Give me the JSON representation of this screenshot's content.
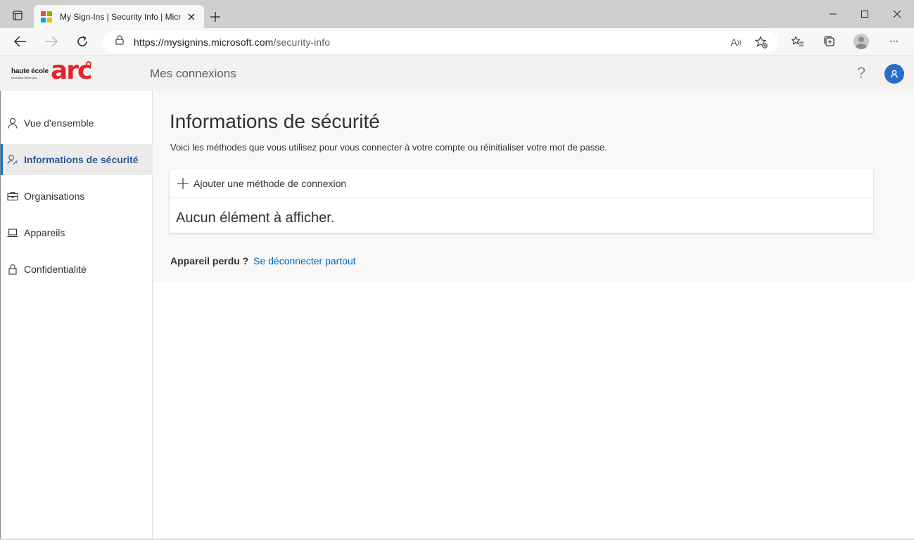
{
  "browser": {
    "tab": {
      "title": "My Sign-Ins | Security Info | Micr",
      "favicon": "microsoft-logo-icon",
      "close": "×"
    },
    "new_tab": "+",
    "window_controls": {
      "minimize": "—",
      "maximize": "☐",
      "close": "✕"
    },
    "address": {
      "url_host": "https://mysignins.microsoft.com",
      "url_path": "/security-info"
    },
    "icons": [
      "back-icon",
      "forward-icon",
      "refresh-icon",
      "lock-icon",
      "read-aloud-icon",
      "add-favorite-icon",
      "favorites-icon",
      "collections-icon",
      "profile-icon",
      "more-icon"
    ],
    "menu_label": "···",
    "read_aloud_label": "A"
  },
  "app": {
    "logo": {
      "line1": "haute école",
      "line2": "neuchâtel berne jura",
      "brand": "arc"
    },
    "title": "Mes connexions",
    "help": "?"
  },
  "sidebar": {
    "items": [
      {
        "label": "Vue d'ensemble",
        "icon": "person-icon",
        "active": false
      },
      {
        "label": "Informations de sécurité",
        "icon": "person-key-icon",
        "active": true
      },
      {
        "label": "Organisations",
        "icon": "briefcase-icon",
        "active": false
      },
      {
        "label": "Appareils",
        "icon": "laptop-icon",
        "active": false
      },
      {
        "label": "Confidentialité",
        "icon": "lock-icon",
        "active": false
      }
    ]
  },
  "main": {
    "title": "Informations de sécurité",
    "description": "Voici les méthodes que vous utilisez pour vous connecter à votre compte ou réinitialiser votre mot de passe.",
    "add_method": "Ajouter une méthode de connexion",
    "empty": "Aucun élément à afficher.",
    "lost_device": "Appareil perdu ?",
    "sign_out_everywhere": "Se déconnecter partout"
  },
  "colors": {
    "accent": "#0078d4",
    "link": "#0064bf",
    "active_text": "#2b579a",
    "brand_red": "#e4232d",
    "avatar": "#2b6ec9"
  }
}
